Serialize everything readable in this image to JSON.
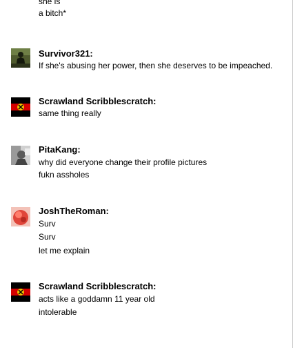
{
  "messages": [
    {
      "sender": "",
      "lines": [
        "she is",
        "a bitch*"
      ]
    },
    {
      "sender": "Survivor321:",
      "avatar": "survivor-avatar",
      "lines": [
        "If she's abusing her power, then she deserves to be impeached."
      ]
    },
    {
      "sender": "Scrawland Scribblescratch:",
      "avatar": "scrawland-avatar",
      "lines": [
        "same thing really"
      ]
    },
    {
      "sender": "PitaKang:",
      "avatar": "pitakang-avatar",
      "lines": [
        "why did everyone change their profile pictures",
        "fukn assholes"
      ]
    },
    {
      "sender": "JoshTheRoman:",
      "avatar": "joshtheroman-avatar",
      "lines": [
        "Surv",
        "Surv",
        "let me explain"
      ]
    },
    {
      "sender": "Scrawland Scribblescratch:",
      "avatar": "scrawland-avatar",
      "lines": [
        "acts like a goddamn 11 year old",
        "intolerable"
      ]
    }
  ],
  "colors": {
    "background": "#ffffff",
    "text": "#000000",
    "divider": "#c8c8c8"
  }
}
